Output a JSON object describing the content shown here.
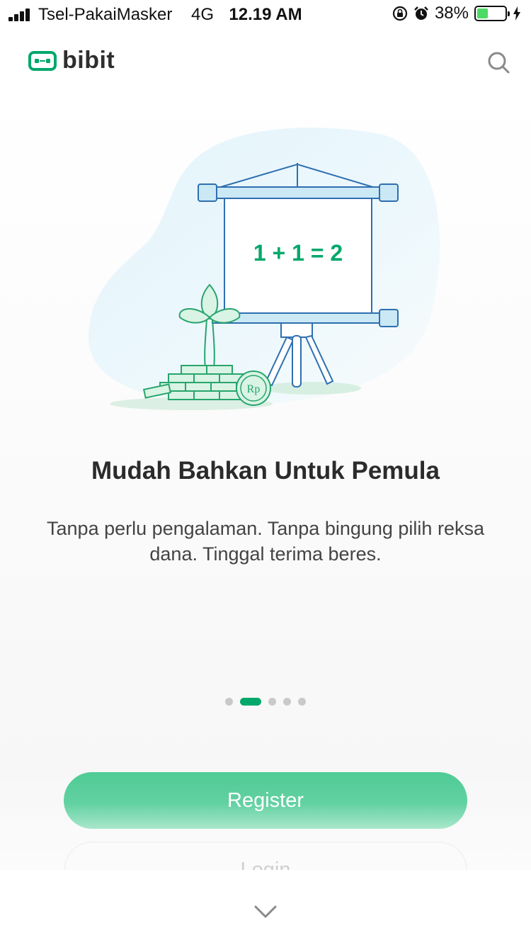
{
  "status_bar": {
    "carrier": "Tsel-PakaiMasker",
    "network": "4G",
    "time": "12.19 AM",
    "battery": "38%",
    "battery_level": 0.38,
    "icons": [
      "signal-icon",
      "rotation-lock-icon",
      "alarm-icon",
      "battery-icon",
      "charging-icon"
    ]
  },
  "header": {
    "brand": "bibit",
    "search_icon": "search-icon"
  },
  "illustration": {
    "board_text": "1 + 1 = 2",
    "coin_text": "Rp"
  },
  "slide": {
    "title": "Mudah Bahkan Untuk Pemula",
    "subtitle": "Tanpa perlu pengalaman. Tanpa bingung pilih reksa dana. Tinggal terima beres."
  },
  "pager": {
    "count": 5,
    "active_index": 1
  },
  "actions": {
    "register_label": "Register",
    "login_label": "Login"
  },
  "colors": {
    "brand_green": "#00a86b",
    "button_green": "#55cc98"
  }
}
